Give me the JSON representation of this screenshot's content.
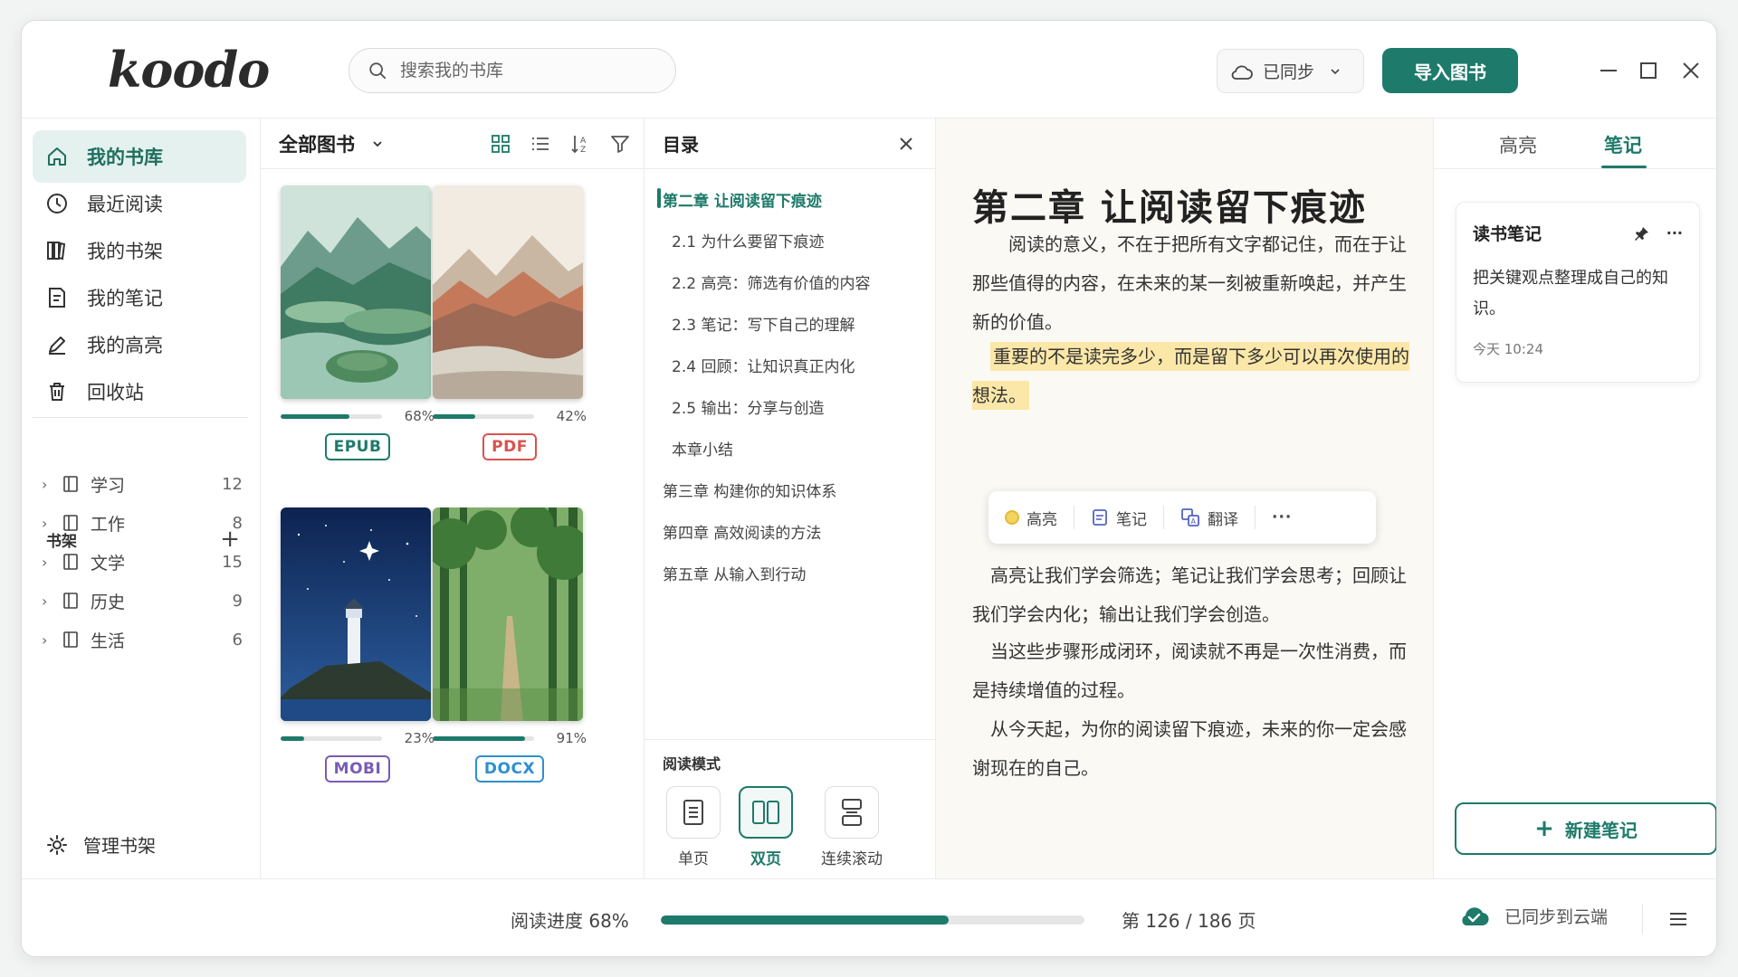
{
  "app": {
    "logo": "koodo"
  },
  "search": {
    "placeholder": "搜索我的书库"
  },
  "topbar": {
    "sync_label": "已同步",
    "import_label": "导入图书"
  },
  "sidebar": {
    "items": [
      {
        "label": "我的书库",
        "icon": "home-icon",
        "active": true
      },
      {
        "label": "最近阅读",
        "icon": "clock-icon"
      },
      {
        "label": "我的书架",
        "icon": "bookshelf-icon"
      },
      {
        "label": "我的笔记",
        "icon": "note-icon"
      },
      {
        "label": "我的高亮",
        "icon": "pen-icon"
      },
      {
        "label": "回收站",
        "icon": "trash-icon"
      }
    ],
    "shelf_header": "书架",
    "shelves": [
      {
        "label": "学习",
        "count": "12"
      },
      {
        "label": "工作",
        "count": "8"
      },
      {
        "label": "文学",
        "count": "15"
      },
      {
        "label": "历史",
        "count": "9"
      },
      {
        "label": "生活",
        "count": "6"
      }
    ],
    "manage_label": "管理书架"
  },
  "library": {
    "title": "全部图书",
    "books": [
      {
        "progress": 0.68,
        "percent": "68%",
        "format": "EPUB",
        "format_color": "#1e7a6a"
      },
      {
        "progress": 0.42,
        "percent": "42%",
        "format": "PDF",
        "format_color": "#d9534f"
      },
      {
        "progress": 0.23,
        "percent": "23%",
        "format": "MOBI",
        "format_color": "#7a5bb5"
      },
      {
        "progress": 0.91,
        "percent": "91%",
        "format": "DOCX",
        "format_color": "#2f8fd0"
      }
    ]
  },
  "toc": {
    "title": "目录",
    "items": [
      {
        "label": "第二章  让阅读留下痕迹",
        "active": true
      },
      {
        "label": "2.1  为什么要留下痕迹"
      },
      {
        "label": "2.2  高亮：筛选有价值的内容"
      },
      {
        "label": "2.3  笔记：写下自己的理解"
      },
      {
        "label": "2.4  回顾：让知识真正内化"
      },
      {
        "label": "2.5  输出：分享与创造"
      },
      {
        "label": "本章小结"
      },
      {
        "label": "第三章  构建你的知识体系"
      },
      {
        "label": "第四章  高效阅读的方法"
      },
      {
        "label": "第五章  从输入到行动"
      }
    ],
    "mode_title": "阅读模式",
    "modes": [
      {
        "label": "单页"
      },
      {
        "label": "双页",
        "active": true
      },
      {
        "label": "连续滚动"
      }
    ]
  },
  "reader": {
    "chapter_title": "第二章  让阅读留下痕迹",
    "p1": "阅读的意义，不在于把所有文字都记住，而在于让那些值得的内容，在未来的某一刻被重新唤起，并产生新的价值。",
    "p2_highlight": "重要的不是读完多少，而是留下多少可以再次使用的想法。",
    "popover": {
      "highlight": "高亮",
      "note": "笔记",
      "translate": "翻译",
      "more": "···"
    },
    "p3": "高亮让我们学会筛选；笔记让我们学会思考；回顾让我们学会内化；输出让我们学会创造。",
    "p4": "当这些步骤形成闭环，阅读就不再是一次性消费，而是持续增值的过程。",
    "p5": "从今天起，为你的阅读留下痕迹，未来的你一定会感谢现在的自己。"
  },
  "notes": {
    "tabs": [
      "高亮",
      "笔记"
    ],
    "active_tab": "笔记",
    "card": {
      "title": "读书笔记",
      "body": "把关键观点整理成自己的知识。",
      "time": "今天 10:24",
      "more": "···"
    },
    "new_note_label": "新建笔记"
  },
  "footer": {
    "progress_label": "阅读进度  68%",
    "progress": 0.68,
    "page_label": "第 126 / 186 页",
    "sync_label": "已同步到云端"
  },
  "colors": {
    "accent": "#1e7a6a",
    "highlight": "#fbe7a8"
  }
}
